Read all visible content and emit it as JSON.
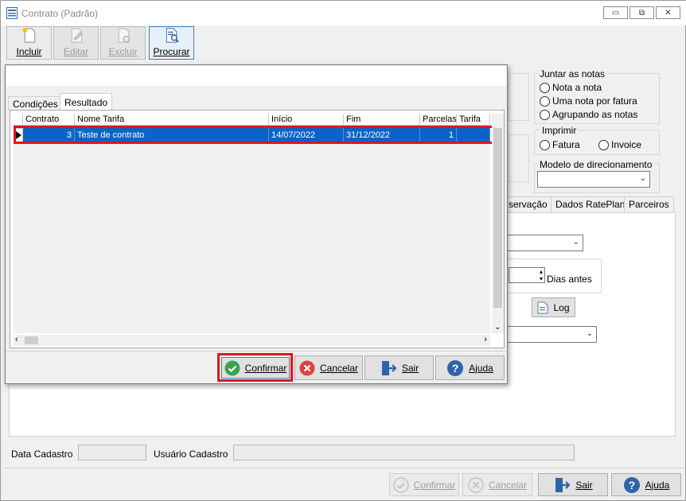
{
  "window": {
    "title": "Contrato (Padrão)",
    "minimize": "▭",
    "maximize": "⧉",
    "close": "✕"
  },
  "toolbar": {
    "buttons": [
      {
        "label": "Incluir",
        "icon": "new-document-icon",
        "enabled": true
      },
      {
        "label": "Editar",
        "icon": "edit-document-icon",
        "enabled": false
      },
      {
        "label": "Excluir",
        "icon": "delete-document-icon",
        "enabled": false
      },
      {
        "label": "Procurar",
        "icon": "search-document-icon",
        "enabled": true
      }
    ]
  },
  "background_form": {
    "juntar_as_notas": {
      "title": "Juntar as notas",
      "options": [
        "Nota a nota",
        "Uma nota por fatura",
        "Agrupando as notas"
      ]
    },
    "imprimir": {
      "title": "Imprimir",
      "options": [
        "Fatura",
        "Invoice"
      ]
    },
    "modelo_direcionamento": {
      "title": "Modelo de direcionamento",
      "value": ""
    },
    "tabs": [
      "servação",
      "Dados RatePlan",
      "Parceiros"
    ],
    "dias_antes_label": "Dias antes",
    "log_button": "Log",
    "footer": {
      "data_cadastro_label": "Data Cadastro",
      "data_cadastro_value": "",
      "usuario_cadastro_label": "Usuário Cadastro",
      "usuario_cadastro_value": ""
    },
    "bottom_buttons": [
      {
        "label": "Confirmar",
        "enabled": false
      },
      {
        "label": "Cancelar",
        "enabled": false
      },
      {
        "label": "Sair",
        "enabled": true
      },
      {
        "label": "Ajuda",
        "enabled": true
      }
    ]
  },
  "dialog": {
    "tabs": [
      "Condições",
      "Resultado"
    ],
    "active_tab": "Resultado",
    "grid": {
      "columns": [
        "Contrato",
        "Nome Tarifa",
        "Início",
        "Fim",
        "Parcelas",
        "Tarifa"
      ],
      "rows": [
        {
          "contrato": "3",
          "nome_tarifa": "Teste de contrato",
          "inicio": "14/07/2022",
          "fim": "31/12/2022",
          "parcelas": "1",
          "tarifa": ""
        }
      ]
    },
    "buttons": {
      "confirmar": "Confirmar",
      "cancelar": "Cancelar",
      "sair": "Sair",
      "ajuda": "Ajuda"
    }
  },
  "colors": {
    "selection": "#0a64c8",
    "highlight_border": "#e0141e",
    "window_bg": "#f0f0f0"
  }
}
